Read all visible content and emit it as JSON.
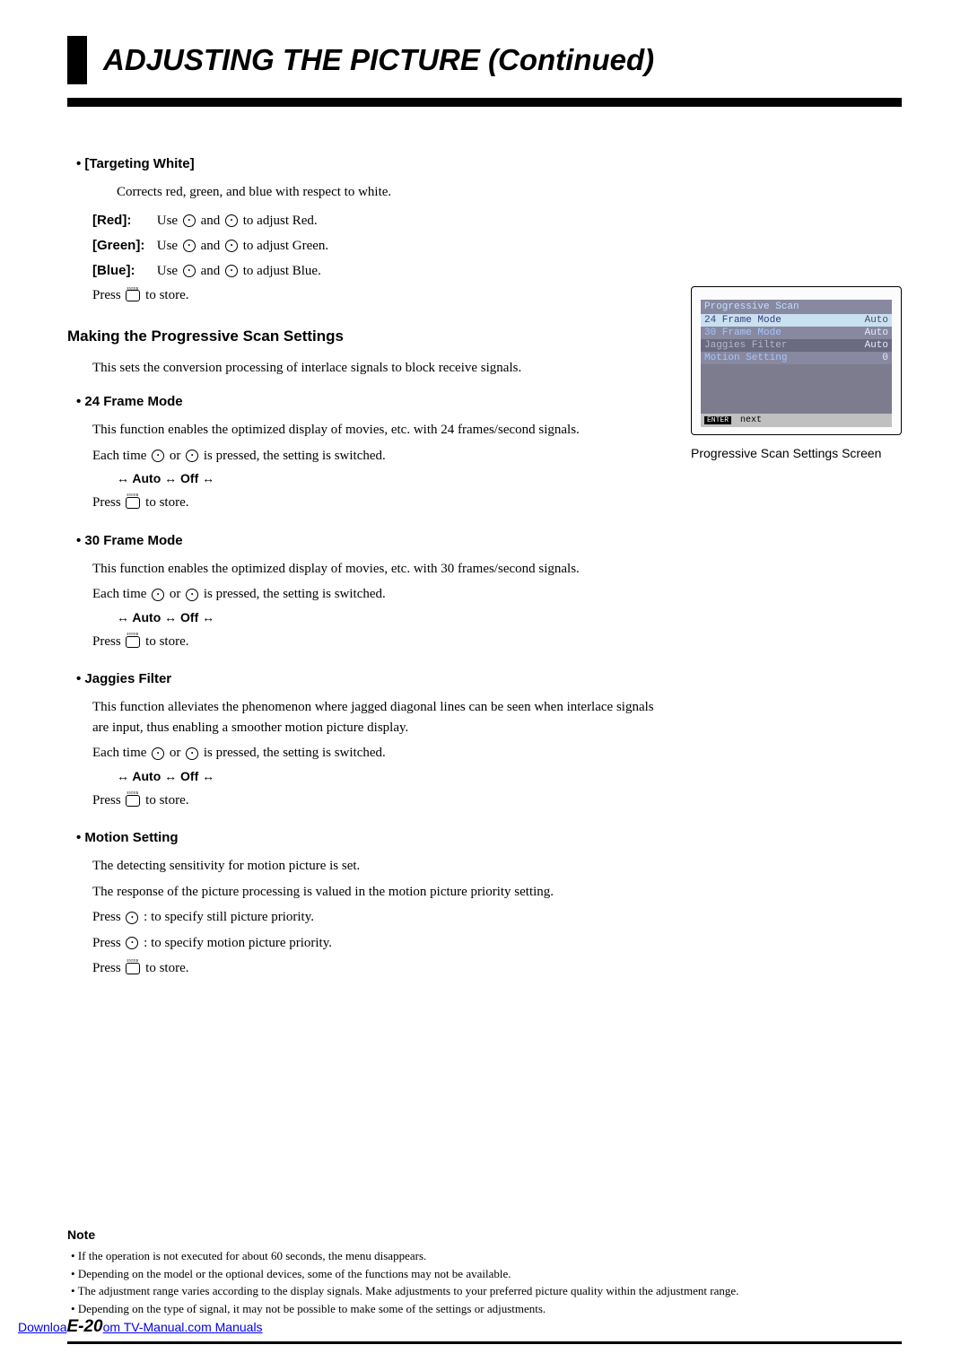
{
  "header": {
    "title": "ADJUSTING THE PICTURE (Continued)"
  },
  "targeting_white": {
    "title": "[Targeting White]",
    "desc": "Corrects red, green, and blue with respect to white.",
    "red_label": "[Red]:",
    "red_text": "to adjust Red.",
    "green_label": "[Green]:",
    "green_text": "to adjust Green.",
    "blue_label": "[Blue]:",
    "blue_text": "to adjust Blue.",
    "press_store": "to store."
  },
  "progressive_scan": {
    "heading": "Making the Progressive Scan Settings",
    "intro": "This sets the conversion processing of interlace signals to block receive signals."
  },
  "frame24": {
    "title": "24 Frame Mode",
    "desc": "This function enables the optimized display of movies, etc. with 24 frames/second signals.",
    "each_time": "is pressed, the setting is switched.",
    "options": "↔ Auto ↔ Off ↔",
    "press_store": "to store."
  },
  "frame30": {
    "title": "30 Frame Mode",
    "desc": "This function enables the optimized display of movies, etc. with 30 frames/second signals.",
    "each_time": "is pressed, the setting is switched.",
    "options": "↔ Auto ↔ Off ↔",
    "press_store": "to store."
  },
  "jaggies": {
    "title": "Jaggies Filter",
    "desc": "This function alleviates the phenomenon where jagged diagonal lines can be seen when interlace signals are input, thus enabling a smoother motion picture display.",
    "each_time": "is pressed, the setting is switched.",
    "options": "↔ Auto ↔ Off ↔",
    "press_store": "to store."
  },
  "motion": {
    "title": "Motion Setting",
    "line1": "The detecting sensitivity for motion picture is set.",
    "line2": "The response of the picture processing is valued in the motion picture priority setting.",
    "press_still": ": to specify still picture priority.",
    "press_motion": ": to specify motion picture priority.",
    "press_store": "to store."
  },
  "screenshot": {
    "menu_title": "Progressive Scan",
    "row1_label": "24 Frame Mode",
    "row1_value": "Auto",
    "row2_label": "30 Frame Mode",
    "row2_value": "Auto",
    "row3_label": "Jaggies Filter",
    "row3_value": "Auto",
    "row4_label": "Motion Setting",
    "row4_value": "0",
    "footer_badge": "ENTER",
    "footer_text": "next",
    "caption": "Progressive Scan Settings Screen"
  },
  "note": {
    "title": "Note",
    "items": [
      "If the operation is not executed for about 60 seconds, the menu disappears.",
      "Depending on the model or the optional devices, some of the functions may not be available.",
      "The adjustment range varies according to the display signals. Make adjustments to your preferred picture quality within the adjustment range.",
      "Depending on the type of signal, it may not be possible to make some of the settings or adjustments."
    ]
  },
  "footer": {
    "download_pre": "Downloa",
    "page_num": "E-20",
    "download_post": "om TV-Manual.com Manuals"
  },
  "common": {
    "use": "Use",
    "and": "and",
    "or": "or",
    "press": "Press",
    "each_time": "Each time"
  }
}
